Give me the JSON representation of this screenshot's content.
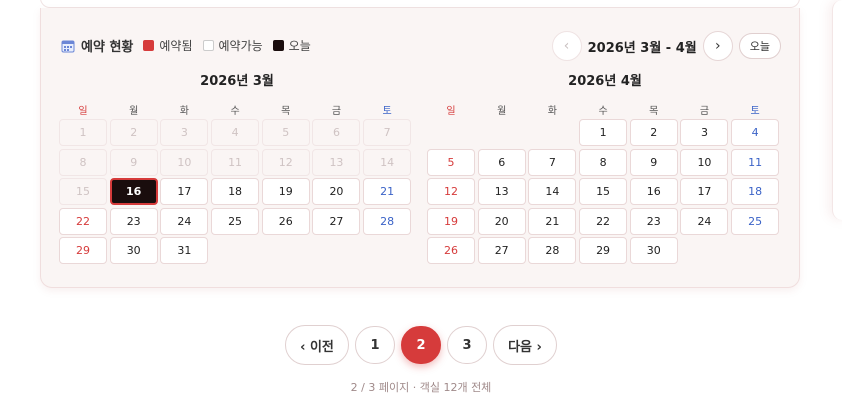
{
  "legend": {
    "title": "예약 현황",
    "booked": "예약됨",
    "available": "예약가능",
    "today": "오늘"
  },
  "nav": {
    "prev": "‹",
    "next": "›",
    "range": "2026년 3월 - 4월",
    "today_button": "오늘"
  },
  "weekdays": [
    "일",
    "월",
    "화",
    "수",
    "목",
    "금",
    "토"
  ],
  "months": [
    {
      "title": "2026년 3월",
      "lead_blanks": 0,
      "days": [
        "1",
        "2",
        "3",
        "4",
        "5",
        "6",
        "7",
        "8",
        "9",
        "10",
        "11",
        "12",
        "13",
        "14",
        "15",
        "16",
        "17",
        "18",
        "19",
        "20",
        "21",
        "22",
        "23",
        "24",
        "25",
        "26",
        "27",
        "28",
        "29",
        "30",
        "31"
      ],
      "past_through": 15,
      "today": 16
    },
    {
      "title": "2026년 4월",
      "lead_blanks": 3,
      "days": [
        "1",
        "2",
        "3",
        "4",
        "5",
        "6",
        "7",
        "8",
        "9",
        "10",
        "11",
        "12",
        "13",
        "14",
        "15",
        "16",
        "17",
        "18",
        "19",
        "20",
        "21",
        "22",
        "23",
        "24",
        "25",
        "26",
        "27",
        "28",
        "29",
        "30"
      ],
      "past_through": 0,
      "today": 0
    }
  ],
  "pagination": {
    "prev": "‹ 이전",
    "pages": [
      "1",
      "2",
      "3"
    ],
    "current": "2",
    "next": "다음 ›",
    "info": "2 / 3 페이지 · 객실 12개 전체"
  },
  "colors": {
    "accent": "#d63b3b",
    "today_bg": "#1a0d0d",
    "saturday": "#3b63c7"
  }
}
